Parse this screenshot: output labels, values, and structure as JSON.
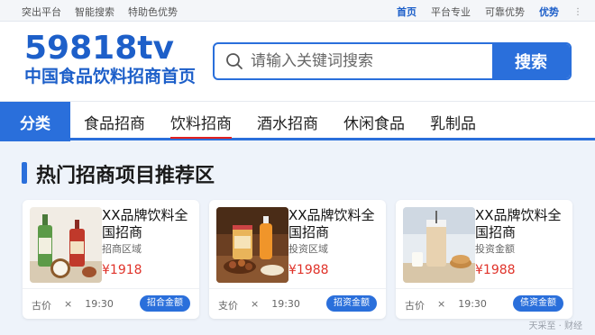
{
  "topbar": {
    "left": [
      "突出平台",
      "智能搜索",
      "特助色优势"
    ],
    "right": [
      {
        "label": "首页",
        "highlight": true
      },
      {
        "label": "平台专业",
        "highlight": false
      },
      {
        "label": "可靠优势",
        "highlight": false
      },
      {
        "label": "优势",
        "highlight": true
      }
    ],
    "more": "⋮"
  },
  "header": {
    "logo_main": "59818tv",
    "logo_sub": "中国食品饮料招商首页",
    "search_placeholder": "请输入关键词搜索",
    "search_button": "搜索"
  },
  "nav": {
    "category_label": "分类",
    "items": [
      "食品招商",
      "饮料招商",
      "酒水招商",
      "休闲食品",
      "乳制品"
    ],
    "active_index": 1
  },
  "section": {
    "title": "热门招商项目推荐区"
  },
  "cards": [
    {
      "title": "XX品牌饮料全国招商",
      "sub": "招商区域",
      "price": "¥1918",
      "foot_a": "古价",
      "foot_x": "×",
      "foot_time": "19:30",
      "badge": "招合金额",
      "image": "bottles-and-coconut"
    },
    {
      "title": "XX品牌饮料全国招商",
      "sub": "投资区域",
      "price": "¥1988",
      "foot_a": "支价",
      "foot_x": "×",
      "foot_time": "19:30",
      "badge": "招资金额",
      "image": "snacks-and-drink"
    },
    {
      "title": "XX品牌饮料全国招商",
      "sub": "投资金额",
      "price": "¥1988",
      "foot_a": "古价",
      "foot_x": "×",
      "foot_time": "19:30",
      "badge": "债资金额",
      "image": "milk-tea"
    }
  ],
  "watermark": "天采至 · 财经",
  "colors": {
    "brand_blue": "#2a6fdb",
    "price_red": "#e0332a",
    "active_underline": "#e02020"
  }
}
